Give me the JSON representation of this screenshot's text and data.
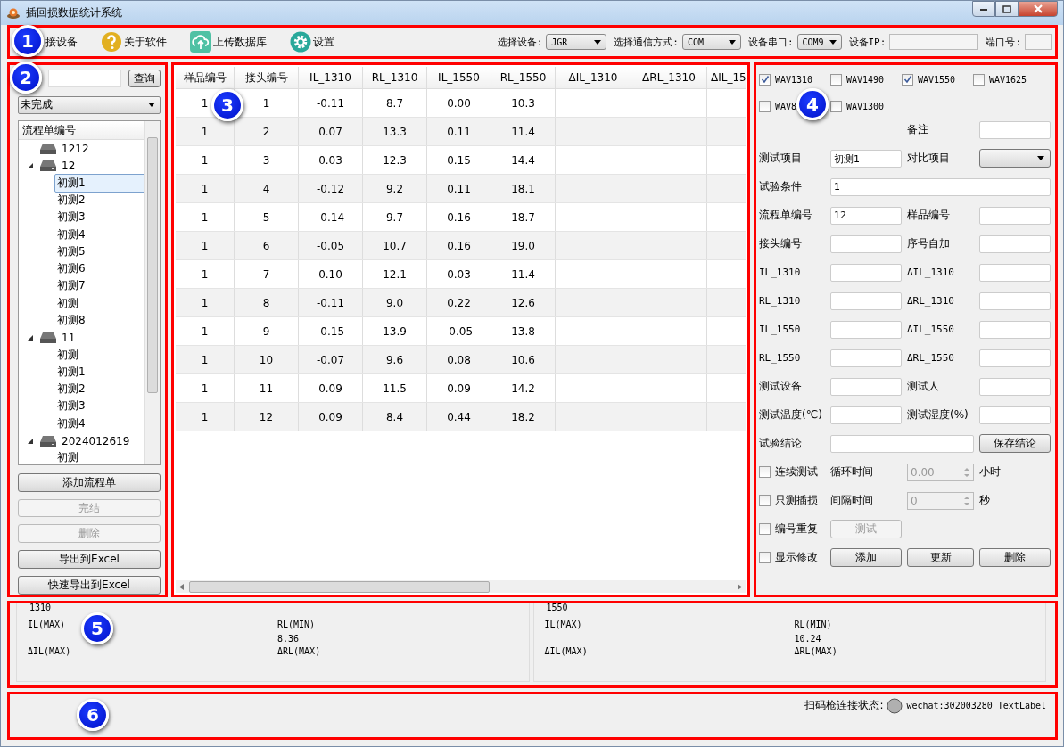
{
  "window": {
    "title": "插回损数据统计系统"
  },
  "toolbar": {
    "badge": "1",
    "buttons": [
      {
        "label": "接设备"
      },
      {
        "label": "关于软件"
      },
      {
        "label": "上传数据库"
      },
      {
        "label": "设置"
      }
    ],
    "fields": [
      {
        "kind": "select",
        "label": "选择设备:",
        "value": "JGR"
      },
      {
        "kind": "select",
        "label": "选择通信方式:",
        "value": "COM"
      },
      {
        "kind": "select",
        "label": "设备串口:",
        "value": "COM9"
      },
      {
        "kind": "input",
        "label": "设备IP:"
      },
      {
        "kind": "input",
        "label": "端口号:"
      }
    ]
  },
  "sidebar": {
    "badge": "2",
    "search_button": "查询",
    "filter": {
      "value": "未完成"
    },
    "tree": {
      "header": "流程单编号",
      "items": [
        {
          "label": "1212"
        },
        {
          "label": "12",
          "expanded": true,
          "children": [
            {
              "label": "初测1",
              "selected": true
            },
            {
              "label": "初测2",
              "selected": false
            },
            {
              "label": "初测3",
              "selected": false
            },
            {
              "label": "初测4",
              "selected": false
            },
            {
              "label": "初测5",
              "selected": false
            },
            {
              "label": "初测6",
              "selected": false
            },
            {
              "label": "初测7",
              "selected": false
            },
            {
              "label": "初测",
              "selected": false
            },
            {
              "label": "初测8",
              "selected": false
            }
          ]
        },
        {
          "label": "11",
          "expanded": true,
          "children": [
            {
              "label": "初测",
              "selected": false
            },
            {
              "label": "初测1",
              "selected": false
            },
            {
              "label": "初测2",
              "selected": false
            },
            {
              "label": "初测3",
              "selected": false
            },
            {
              "label": "初测4",
              "selected": false
            }
          ]
        },
        {
          "label": "2024012619",
          "expanded": true,
          "children": [
            {
              "label": "初测",
              "selected": false
            }
          ]
        }
      ]
    },
    "buttons": [
      {
        "label": "添加流程单",
        "disabled": false
      },
      {
        "label": "完结",
        "disabled": true
      },
      {
        "label": "删除",
        "disabled": true
      },
      {
        "label": "导出到Excel",
        "disabled": false
      },
      {
        "label": "快速导出到Excel",
        "disabled": false
      }
    ]
  },
  "table": {
    "badge": "3",
    "columns": [
      "样品编号",
      "接头编号",
      "IL_1310",
      "RL_1310",
      "IL_1550",
      "RL_1550",
      "ΔIL_1310",
      "ΔRL_1310",
      "ΔIL_15"
    ],
    "rows": [
      [
        "1",
        "1",
        "-0.11",
        "8.7",
        "0.00",
        "10.3"
      ],
      [
        "1",
        "2",
        "0.07",
        "13.3",
        "0.11",
        "11.4"
      ],
      [
        "1",
        "3",
        "0.03",
        "12.3",
        "0.15",
        "14.4"
      ],
      [
        "1",
        "4",
        "-0.12",
        "9.2",
        "0.11",
        "18.1"
      ],
      [
        "1",
        "5",
        "-0.14",
        "9.7",
        "0.16",
        "18.7"
      ],
      [
        "1",
        "6",
        "-0.05",
        "10.7",
        "0.16",
        "19.0"
      ],
      [
        "1",
        "7",
        "0.10",
        "12.1",
        "0.03",
        "11.4"
      ],
      [
        "1",
        "8",
        "-0.11",
        "9.0",
        "0.22",
        "12.6"
      ],
      [
        "1",
        "9",
        "-0.15",
        "13.9",
        "-0.05",
        "13.8"
      ],
      [
        "1",
        "10",
        "-0.07",
        "9.6",
        "0.08",
        "10.6"
      ],
      [
        "1",
        "11",
        "0.09",
        "11.5",
        "0.09",
        "14.2"
      ],
      [
        "1",
        "12",
        "0.09",
        "8.4",
        "0.44",
        "18.2"
      ]
    ]
  },
  "form": {
    "badge": "4",
    "wavelengths": [
      {
        "label": "WAV1310",
        "checked": true
      },
      {
        "label": "WAV1490",
        "checked": false
      },
      {
        "label": "WAV1550",
        "checked": true
      },
      {
        "label": "WAV1625",
        "checked": false
      },
      {
        "label": "WAV8",
        "checked": false
      },
      {
        "label": "WAV1300",
        "checked": false
      }
    ],
    "remark": {
      "label": "备注"
    },
    "rows": [
      [
        {
          "kind": "label",
          "text": "测试项目"
        },
        {
          "kind": "input",
          "value": "初测1"
        },
        {
          "kind": "label",
          "text": "对比项目"
        },
        {
          "kind": "select"
        }
      ],
      [
        {
          "kind": "label",
          "text": "试验条件"
        },
        {
          "kind": "input",
          "value": "1"
        }
      ],
      [
        {
          "kind": "label",
          "text": "流程单编号"
        },
        {
          "kind": "input",
          "value": "12"
        },
        {
          "kind": "label",
          "text": "样品编号"
        },
        {
          "kind": "input"
        }
      ],
      [
        {
          "kind": "label",
          "text": "接头编号"
        },
        {
          "kind": "input"
        },
        {
          "kind": "label",
          "text": "序号自加"
        },
        {
          "kind": "input"
        }
      ],
      [
        {
          "kind": "mono",
          "text": "IL_1310"
        },
        {
          "kind": "input"
        },
        {
          "kind": "mono",
          "text": "ΔIL_1310"
        },
        {
          "kind": "input"
        }
      ],
      [
        {
          "kind": "mono",
          "text": "RL_1310"
        },
        {
          "kind": "input"
        },
        {
          "kind": "mono",
          "text": "ΔRL_1310"
        },
        {
          "kind": "input"
        }
      ],
      [
        {
          "kind": "mono",
          "text": "IL_1550"
        },
        {
          "kind": "input"
        },
        {
          "kind": "mono",
          "text": "ΔIL_1550"
        },
        {
          "kind": "input"
        }
      ],
      [
        {
          "kind": "mono",
          "text": "RL_1550"
        },
        {
          "kind": "input"
        },
        {
          "kind": "mono",
          "text": "ΔRL_1550"
        },
        {
          "kind": "input"
        }
      ],
      [
        {
          "kind": "label",
          "text": "测试设备"
        },
        {
          "kind": "input"
        },
        {
          "kind": "label",
          "text": "测试人"
        },
        {
          "kind": "input"
        }
      ],
      [
        {
          "kind": "label",
          "text": "测试温度(℃)"
        },
        {
          "kind": "input"
        },
        {
          "kind": "label",
          "text": "测试湿度(%)"
        },
        {
          "kind": "input"
        }
      ],
      [
        {
          "kind": "label",
          "text": "试验结论"
        },
        {
          "kind": "input"
        },
        {
          "kind": "button",
          "text": "保存结论",
          "disabled": false
        }
      ],
      [
        {
          "kind": "checkbox",
          "text": "连续测试",
          "checked": false
        },
        {
          "kind": "label",
          "text": "循环时间"
        },
        {
          "kind": "spin",
          "value": "0.00",
          "disabled": true
        },
        {
          "kind": "label",
          "text": "小时"
        }
      ],
      [
        {
          "kind": "checkbox",
          "text": "只测插损",
          "checked": false
        },
        {
          "kind": "label",
          "text": "间隔时间"
        },
        {
          "kind": "spin",
          "value": "0",
          "disabled": true
        },
        {
          "kind": "label",
          "text": "秒"
        }
      ],
      [
        {
          "kind": "checkbox",
          "text": "编号重复",
          "checked": false
        },
        {
          "kind": "button",
          "text": "测试",
          "disabled": true
        }
      ],
      [
        {
          "kind": "checkbox",
          "text": "显示修改",
          "checked": false
        },
        {
          "kind": "button",
          "text": "添加",
          "disabled": false
        },
        {
          "kind": "button",
          "text": "更新",
          "disabled": false
        },
        {
          "kind": "button",
          "text": "删除",
          "disabled": false
        }
      ]
    ]
  },
  "stats": {
    "badge": "5",
    "groups": [
      {
        "title": "1310",
        "items": [
          {
            "label": "IL(MAX)"
          },
          {
            "label": "RL(MIN)",
            "value": "8.36"
          },
          {
            "label": "ΔIL(MAX)"
          },
          {
            "label": "ΔRL(MAX)"
          }
        ]
      },
      {
        "title": "1550",
        "items": [
          {
            "label": "IL(MAX)"
          },
          {
            "label": "RL(MIN)",
            "value": "10.24"
          },
          {
            "label": "ΔIL(MAX)"
          },
          {
            "label": "ΔRL(MAX)"
          }
        ]
      }
    ]
  },
  "status_bar": {
    "badge": "6",
    "scanner_label": "扫码枪连接状态:",
    "text": "wechat:302003280 TextLabel"
  }
}
